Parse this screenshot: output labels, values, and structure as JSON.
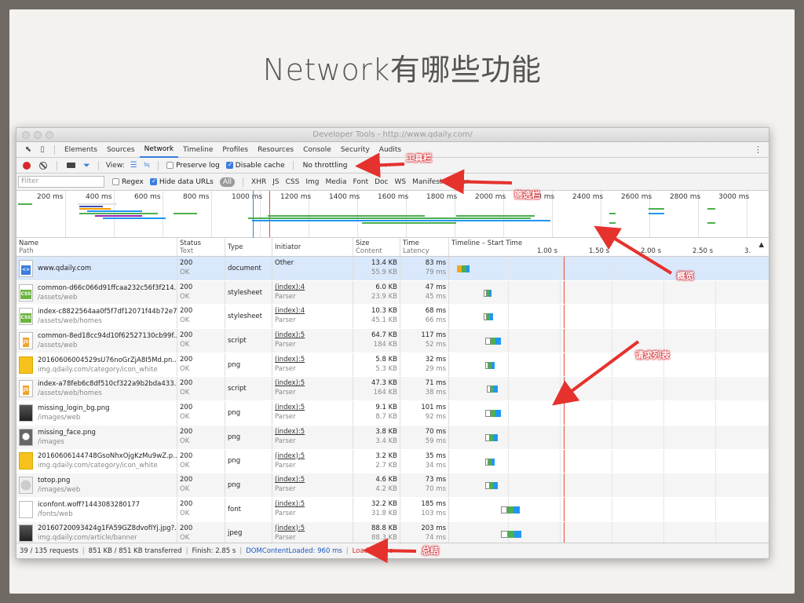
{
  "slide": {
    "title": "Network有哪些功能"
  },
  "window": {
    "title": "Developer Tools - http://www.qdaily.com/"
  },
  "tabs": [
    "Elements",
    "Sources",
    "Network",
    "Timeline",
    "Profiles",
    "Resources",
    "Console",
    "Security",
    "Audits"
  ],
  "active_tab": "Network",
  "toolbar": {
    "view_label": "View:",
    "preserve_log": "Preserve log",
    "disable_cache": "Disable cache",
    "throttling": "No throttling"
  },
  "filterbar": {
    "placeholder": "Filter",
    "regex": "Regex",
    "hide_data_urls": "Hide data URLs",
    "all": "All",
    "types": [
      "XHR",
      "JS",
      "CSS",
      "Img",
      "Media",
      "Font",
      "Doc",
      "WS",
      "Manifest",
      "Other"
    ]
  },
  "overview": {
    "ticks": [
      "200 ms",
      "400 ms",
      "600 ms",
      "800 ms",
      "1000 ms",
      "1200 ms",
      "1400 ms",
      "1600 ms",
      "1800 ms",
      "2000 ms",
      "2200 ms",
      "2400 ms",
      "2600 ms",
      "2800 ms",
      "3000 ms"
    ]
  },
  "columns": {
    "name": "Name",
    "name_sub": "Path",
    "status": "Status",
    "status_sub": "Text",
    "type": "Type",
    "initiator": "Initiator",
    "size": "Size",
    "size_sub": "Content",
    "time": "Time",
    "time_sub": "Latency",
    "timeline": "Timeline – Start Time",
    "timeline_ticks": [
      "1.00 s",
      "1.50 s",
      "2.00 s",
      "2.50 s",
      "3."
    ]
  },
  "rows": [
    {
      "name": "www.qdaily.com",
      "path": "",
      "status": "200",
      "text": "OK",
      "type": "document",
      "initiator": "Other",
      "init_sub": "",
      "size": "13.4 KB",
      "content": "55.9 KB",
      "time": "83 ms",
      "latency": "79 ms",
      "icon": "html-icon",
      "wf": [
        10,
        16
      ]
    },
    {
      "name": "common-d66c066d91ffcaa232c56f3f214...",
      "path": "/assets/web",
      "status": "200",
      "text": "OK",
      "type": "stylesheet",
      "initiator": "(index):4",
      "init_sub": "Parser",
      "size": "6.0 KB",
      "content": "23.9 KB",
      "time": "47 ms",
      "latency": "45 ms",
      "icon": "css-icon",
      "wf": [
        44,
        10
      ]
    },
    {
      "name": "index-c8822564aa0f5f7df12071f44b72e7...",
      "path": "/assets/web/homes",
      "status": "200",
      "text": "OK",
      "type": "stylesheet",
      "initiator": "(index):4",
      "init_sub": "Parser",
      "size": "10.3 KB",
      "content": "45.1 KB",
      "time": "68 ms",
      "latency": "66 ms",
      "icon": "css-icon",
      "wf": [
        44,
        12
      ]
    },
    {
      "name": "common-8ed18cc94d10f62527130cb99f...",
      "path": "/assets/web",
      "status": "200",
      "text": "OK",
      "type": "script",
      "initiator": "(index):5",
      "init_sub": "Parser",
      "size": "64.7 KB",
      "content": "184 KB",
      "time": "117 ms",
      "latency": "52 ms",
      "icon": "js-icon",
      "wf": [
        46,
        20
      ]
    },
    {
      "name": "20160606004529sU76noGrZjA8I5Md.pn...",
      "path": "img.qdaily.com/category/icon_white",
      "status": "200",
      "text": "OK",
      "type": "png",
      "initiator": "(index):5",
      "init_sub": "Parser",
      "size": "5.8 KB",
      "content": "5.3 KB",
      "time": "32 ms",
      "latency": "29 ms",
      "icon": "img-yellow-icon",
      "wf": [
        46,
        12
      ]
    },
    {
      "name": "index-a78feb6c8df510cf322a9b2bda433...",
      "path": "/assets/web/homes",
      "status": "200",
      "text": "OK",
      "type": "script",
      "initiator": "(index):5",
      "init_sub": "Parser",
      "size": "47.3 KB",
      "content": "164 KB",
      "time": "71 ms",
      "latency": "38 ms",
      "icon": "js-icon",
      "wf": [
        48,
        14
      ]
    },
    {
      "name": "missing_login_bg.png",
      "path": "/images/web",
      "status": "200",
      "text": "OK",
      "type": "png",
      "initiator": "(index):5",
      "init_sub": "Parser",
      "size": "9.1 KB",
      "content": "8.7 KB",
      "time": "101 ms",
      "latency": "92 ms",
      "icon": "img-dark-icon",
      "wf": [
        46,
        20
      ]
    },
    {
      "name": "missing_face.png",
      "path": "/images",
      "status": "200",
      "text": "OK",
      "type": "png",
      "initiator": "(index):5",
      "init_sub": "Parser",
      "size": "3.8 KB",
      "content": "3.4 KB",
      "time": "70 ms",
      "latency": "59 ms",
      "icon": "img-face-icon",
      "wf": [
        46,
        16
      ]
    },
    {
      "name": "20160606144748GsoNhxOjgKzMu9wZ.p...",
      "path": "img.qdaily.com/category/icon_white",
      "status": "200",
      "text": "OK",
      "type": "png",
      "initiator": "(index):5",
      "init_sub": "Parser",
      "size": "3.2 KB",
      "content": "2.7 KB",
      "time": "35 ms",
      "latency": "34 ms",
      "icon": "img-yellow-icon",
      "wf": [
        46,
        12
      ]
    },
    {
      "name": "totop.png",
      "path": "/images/web",
      "status": "200",
      "text": "OK",
      "type": "png",
      "initiator": "(index):5",
      "init_sub": "Parser",
      "size": "4.6 KB",
      "content": "4.2 KB",
      "time": "73 ms",
      "latency": "70 ms",
      "icon": "img-totop-icon",
      "wf": [
        46,
        16
      ]
    },
    {
      "name": "iconfont.woff?1443083280177",
      "path": "/fonts/web",
      "status": "200",
      "text": "OK",
      "type": "font",
      "initiator": "(index):5",
      "init_sub": "Parser",
      "size": "32.2 KB",
      "content": "31.8 KB",
      "time": "185 ms",
      "latency": "103 ms",
      "icon": "font-icon",
      "wf": [
        66,
        24
      ]
    },
    {
      "name": "20160720093424g1FA59GZ8dvofIYj.jpg?...",
      "path": "img.qdaily.com/article/banner",
      "status": "200",
      "text": "OK",
      "type": "jpeg",
      "initiator": "(index):5",
      "init_sub": "Parser",
      "size": "88.8 KB",
      "content": "88.3 KB",
      "time": "203 ms",
      "latency": "74 ms",
      "icon": "img-dark-icon",
      "wf": [
        66,
        26
      ]
    }
  ],
  "status": {
    "requests": "39 / 135 requests",
    "transferred": "851 KB / 851 KB transferred",
    "finish": "Finish: 2.85 s",
    "dcl": "DOMContentLoaded: 960 ms",
    "load": "Load: 1.03 s"
  },
  "annotations": {
    "toolbar": "工具栏",
    "filterbar": "筛选栏",
    "overview": "概览",
    "requests": "请求列表",
    "summary": "总结"
  },
  "colors": {
    "accent": "#3b7ddd",
    "record": "#d9262a",
    "annotation": "#e5322d"
  }
}
